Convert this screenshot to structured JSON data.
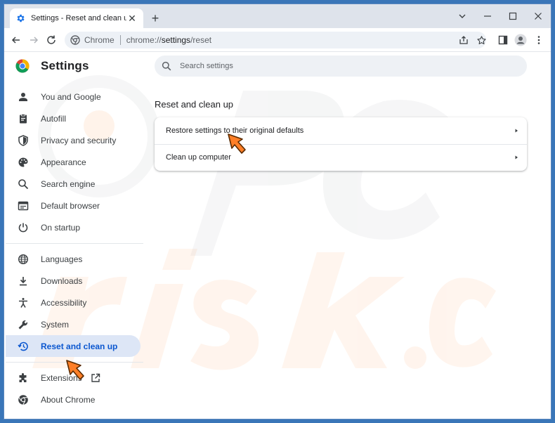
{
  "tab": {
    "title": "Settings - Reset and clean up",
    "close_glyph": "✕",
    "new_tab_glyph": "+"
  },
  "omnibox": {
    "site_label": "Chrome",
    "url_prefix": "chrome://",
    "url_host": "settings",
    "url_path": "/reset"
  },
  "app": {
    "title": "Settings"
  },
  "search": {
    "placeholder": "Search settings"
  },
  "sidebar": {
    "items": [
      {
        "label": "You and Google",
        "icon": "person-icon"
      },
      {
        "label": "Autofill",
        "icon": "clipboard-icon"
      },
      {
        "label": "Privacy and security",
        "icon": "shield-icon"
      },
      {
        "label": "Appearance",
        "icon": "palette-icon"
      },
      {
        "label": "Search engine",
        "icon": "search-icon"
      },
      {
        "label": "Default browser",
        "icon": "browser-icon"
      },
      {
        "label": "On startup",
        "icon": "power-icon"
      },
      {
        "label": "Languages",
        "icon": "globe-icon"
      },
      {
        "label": "Downloads",
        "icon": "download-icon"
      },
      {
        "label": "Accessibility",
        "icon": "accessibility-icon"
      },
      {
        "label": "System",
        "icon": "wrench-icon"
      },
      {
        "label": "Reset and clean up",
        "icon": "restore-icon",
        "active": true
      },
      {
        "label": "Extensions",
        "icon": "puzzle-icon"
      },
      {
        "label": "About Chrome",
        "icon": "chrome-icon"
      }
    ]
  },
  "main": {
    "section_title": "Reset and clean up",
    "rows": [
      {
        "label": "Restore settings to their original defaults"
      },
      {
        "label": "Clean up computer"
      }
    ]
  },
  "colors": {
    "accent": "#0b57d0",
    "active_bg": "#dde6f6",
    "cursor": "#ff7f27"
  }
}
